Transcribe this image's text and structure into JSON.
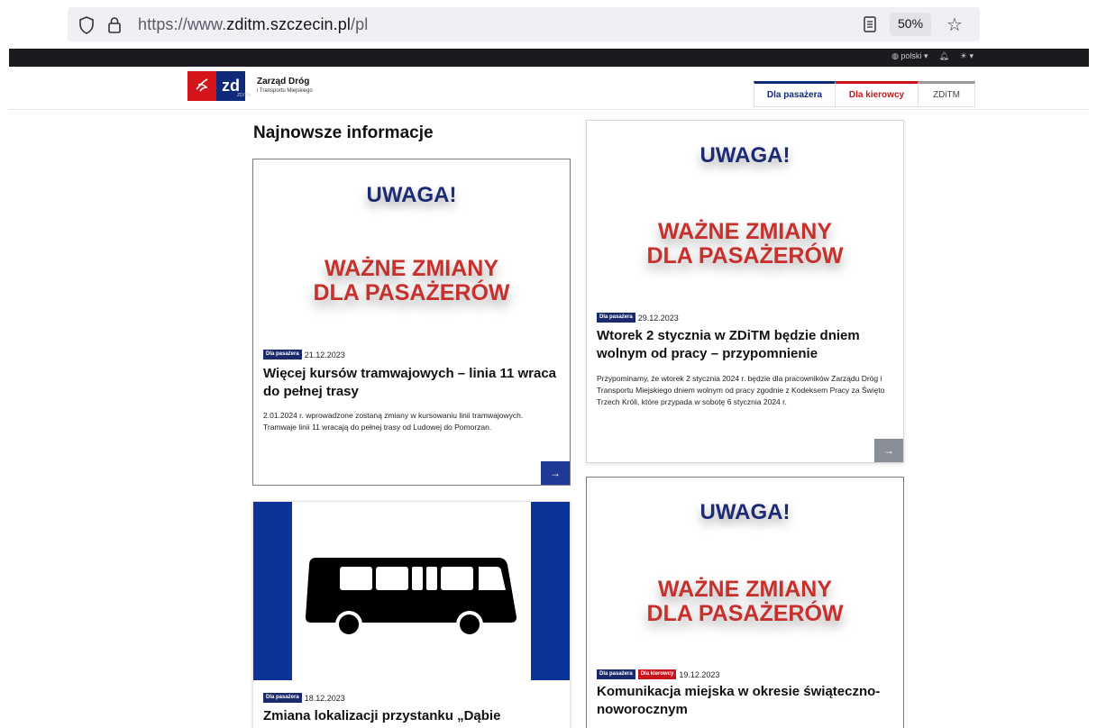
{
  "browser": {
    "url_prefix": "https://www.",
    "url_domain": "zditm.szczecin.pl",
    "url_path": "/pl",
    "zoom": "50%"
  },
  "topbar": {
    "language": "polski",
    "bell_icon": "bell-icon",
    "theme_icon": "sun-icon"
  },
  "site": {
    "logo_mark": "zd",
    "logo_small": "ZDiTM",
    "name_line1": "Zarząd Dróg",
    "name_line2": "i Transportu Miejskiego",
    "nav": [
      "Dla pasażera",
      "Dla kierowcy",
      "ZDiTM"
    ]
  },
  "section_title": "Najnowsze informacje",
  "banner": {
    "uwaga": "UWAGA!",
    "wazne1": "WAŻNE ZMIANY",
    "wazne2": "DLA PASAŻERÓW"
  },
  "cards": [
    {
      "tags": [
        "Dla pasażera"
      ],
      "date": "21.12.2023",
      "title": "Więcej kursów tramwajowych – linia 11 wraca do pełnej trasy",
      "desc": "2.01.2024 r. wprowadzone zostaną zmiany w kursowaniu linii tramwajowych. Tramwaje linii 11 wracają do pełnej trasy od Ludowej do Pomorzan."
    },
    {
      "tags": [
        "Dla pasażera"
      ],
      "date": "29.12.2023",
      "title": "Wtorek 2 stycznia w ZDiTM będzie dniem wolnym od pracy – przypomnienie",
      "desc": "Przypominamy, że wtorek 2 stycznia 2024 r. będzie dla pracowników Zarządu Dróg i Transportu Miejskiego dniem wolnym od pracy zgodnie z Kodeksem Pracy za Święto Trzech Króli, które przypada w sobotę 6 stycznia 2024 r."
    },
    {
      "tags": [
        "Dla pasażera"
      ],
      "date": "18.12.2023",
      "title": "Zmiana lokalizacji przystanku „Dąbie"
    },
    {
      "tags": [
        "Dla pasażera",
        "Dla kierowcy"
      ],
      "date": "19.12.2023",
      "title": "Komunikacja miejska w okresie świąteczno-noworocznym"
    }
  ],
  "arrow_glyph": "→"
}
